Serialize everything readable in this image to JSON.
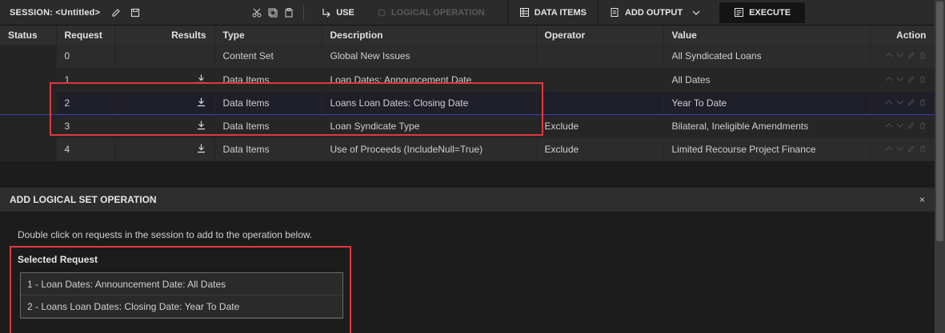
{
  "toolbar": {
    "session_title": "SESSION: <Untitled>",
    "use_label": "USE",
    "logical_op_label": "LOGICAL OPERATION",
    "data_items_label": "DATA ITEMS",
    "add_output_label": "ADD OUTPUT",
    "execute_label": "EXECUTE"
  },
  "table": {
    "headers": {
      "status": "Status",
      "request": "Request",
      "results": "Results",
      "type": "Type",
      "description": "Description",
      "operator": "Operator",
      "value": "Value",
      "action": "Action"
    },
    "rows": [
      {
        "request": "0",
        "type": "Content Set",
        "description": "Global New Issues",
        "operator": "",
        "value": "All Syndicated Loans",
        "download": false
      },
      {
        "request": "1",
        "type": "Data Items",
        "description": "Loan Dates: Announcement Date",
        "operator": "",
        "value": "All Dates",
        "download": true
      },
      {
        "request": "2",
        "type": "Data Items",
        "description": "Loans Loan Dates: Closing Date",
        "operator": "",
        "value": "Year To Date",
        "download": true
      },
      {
        "request": "3",
        "type": "Data Items",
        "description": "Loan Syndicate Type",
        "operator": "Exclude",
        "value": "Bilateral, Ineligible Amendments",
        "download": true
      },
      {
        "request": "4",
        "type": "Data Items",
        "description": "Use of Proceeds (IncludeNull=True)",
        "operator": "Exclude",
        "value": "Limited Recourse Project Finance",
        "download": true
      }
    ]
  },
  "panel": {
    "title": "ADD LOGICAL SET OPERATION",
    "close": "×",
    "instructions": "Double click on requests in the session to add to the operation below.",
    "selected_label": "Selected Request",
    "selected_items": [
      "1 - Loan Dates: Announcement Date: All Dates",
      "2 - Loans Loan Dates: Closing Date: Year To Date"
    ]
  },
  "colors": {
    "highlight": "#e0383f",
    "selected_row_border": "#3a3ab8"
  }
}
